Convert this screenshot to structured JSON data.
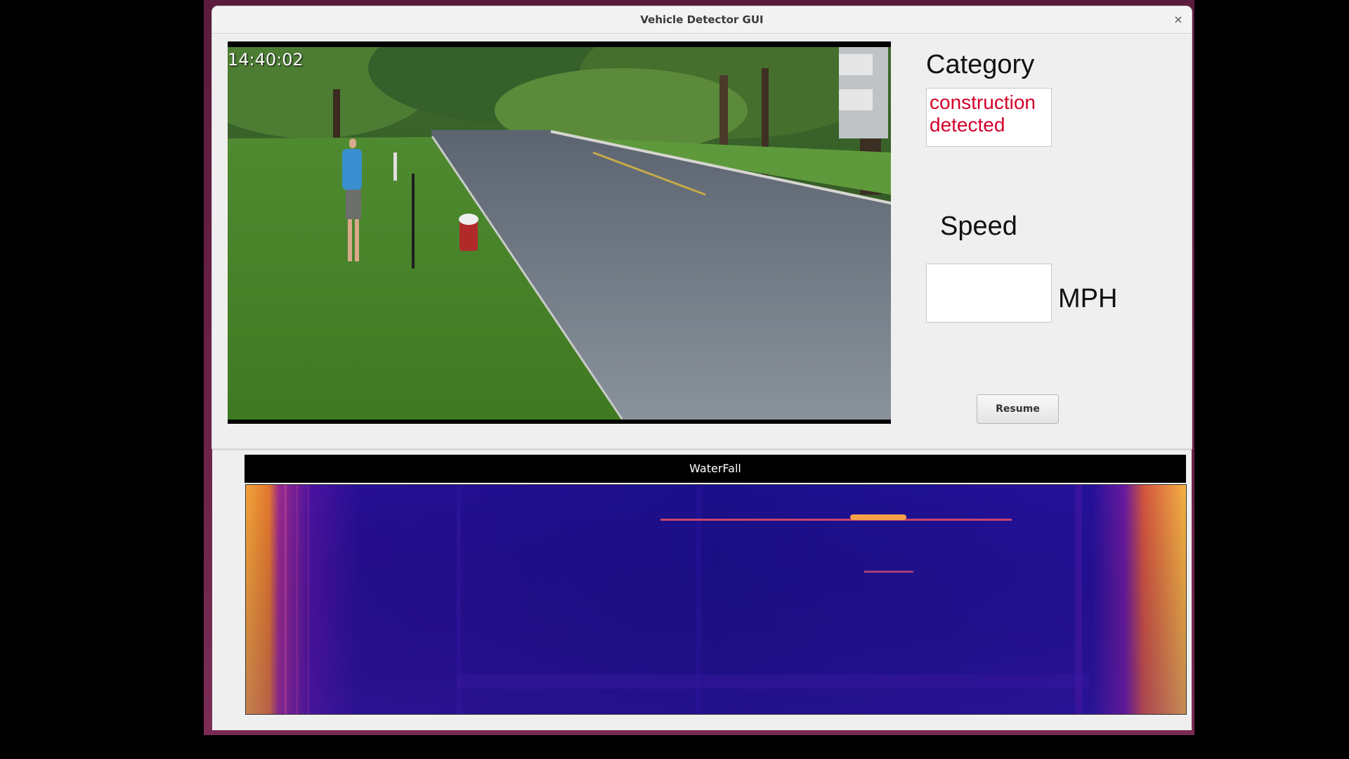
{
  "window": {
    "title": "Vehicle Detector GUI",
    "close_glyph": "×"
  },
  "video": {
    "timestamp": "14:40:02"
  },
  "category": {
    "label": "Category",
    "value": "construction detected",
    "value_color": "#d4002a"
  },
  "speed": {
    "label": "Speed",
    "value": "",
    "unit": "MPH"
  },
  "controls": {
    "resume_label": "Resume"
  },
  "waterfall": {
    "title": "WaterFall"
  },
  "icons": {
    "close": "close-icon"
  }
}
